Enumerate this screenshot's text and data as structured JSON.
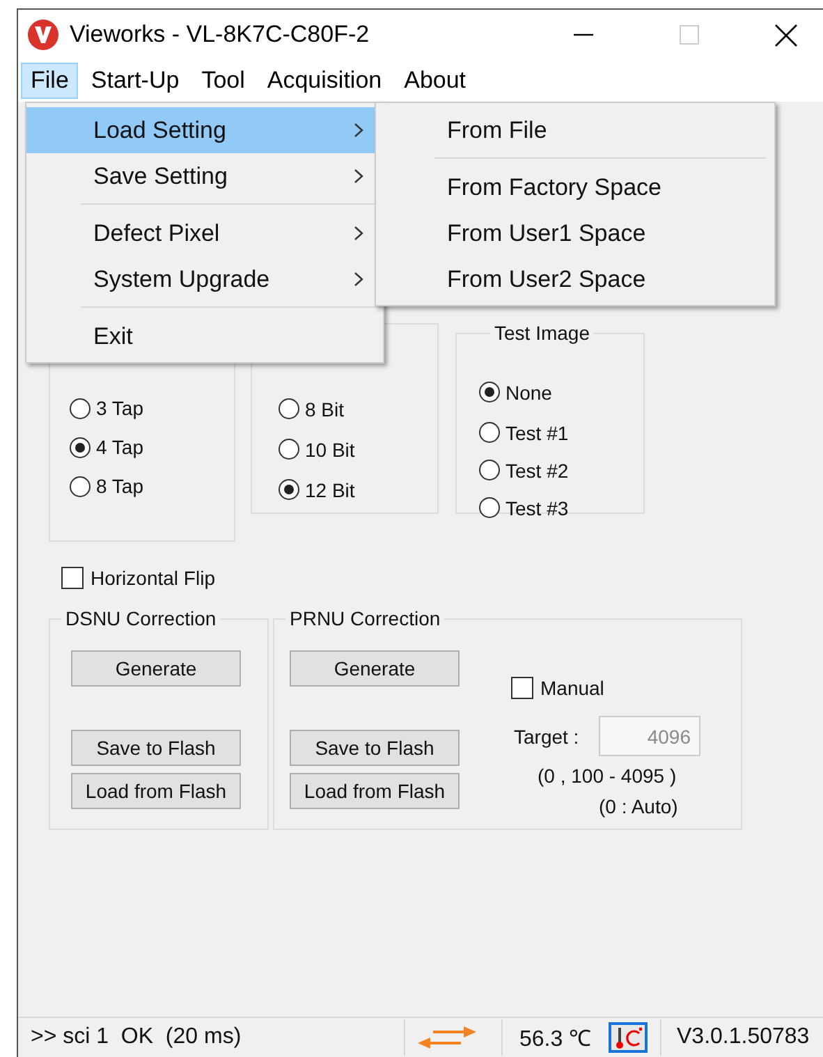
{
  "window": {
    "title": "Vieworks - VL-8K7C-C80F-2"
  },
  "menu_bar": [
    {
      "label": "File",
      "selected": true
    },
    {
      "label": "Start-Up",
      "selected": false
    },
    {
      "label": "Tool",
      "selected": false
    },
    {
      "label": "Acquisition",
      "selected": false
    },
    {
      "label": "About",
      "selected": false
    }
  ],
  "file_menu": {
    "items": [
      {
        "kind": "item",
        "label": "Load Setting",
        "submenu": true,
        "selected": true
      },
      {
        "kind": "item",
        "label": "Save Setting",
        "submenu": true,
        "selected": false
      },
      {
        "kind": "separator"
      },
      {
        "kind": "item",
        "label": "Defect Pixel",
        "submenu": true,
        "selected": false
      },
      {
        "kind": "item",
        "label": "System Upgrade",
        "submenu": true,
        "selected": false
      },
      {
        "kind": "separator"
      },
      {
        "kind": "item",
        "label": "Exit",
        "submenu": false,
        "selected": false
      }
    ]
  },
  "load_setting_submenu": {
    "items": [
      {
        "kind": "item",
        "label": "From File",
        "submenu": false,
        "selected": false
      },
      {
        "kind": "separator"
      },
      {
        "kind": "item",
        "label": "From Factory Space",
        "submenu": false,
        "selected": false
      },
      {
        "kind": "item",
        "label": "From User1 Space",
        "submenu": false,
        "selected": false
      },
      {
        "kind": "item",
        "label": "From User2 Space",
        "submenu": false,
        "selected": false
      }
    ]
  },
  "tap_group": {
    "options": [
      {
        "label": "3 Tap",
        "selected": false
      },
      {
        "label": "4 Tap",
        "selected": true
      },
      {
        "label": "8 Tap",
        "selected": false
      }
    ]
  },
  "bit_group": {
    "options": [
      {
        "label": "8 Bit",
        "selected": false
      },
      {
        "label": "10 Bit",
        "selected": false
      },
      {
        "label": "12 Bit",
        "selected": true
      }
    ]
  },
  "test_image": {
    "title": "Test Image",
    "options": [
      {
        "label": "None",
        "selected": true
      },
      {
        "label": "Test #1",
        "selected": false
      },
      {
        "label": "Test #2",
        "selected": false
      },
      {
        "label": "Test #3",
        "selected": false
      }
    ]
  },
  "horizontal_flip": {
    "label": "Horizontal Flip",
    "checked": false
  },
  "dsnu": {
    "title": "DSNU Correction",
    "buttons": [
      "Generate",
      "Save to Flash",
      "Load from Flash"
    ]
  },
  "prnu": {
    "title": "PRNU Correction",
    "buttons": [
      "Generate",
      "Save to Flash",
      "Load from Flash"
    ],
    "manual": {
      "label": "Manual",
      "checked": false
    },
    "target": {
      "label": "Target :",
      "value": "4096",
      "disabled": true
    },
    "range": "(0 , 100 - 4095 )",
    "auto_note": "(0 : Auto)"
  },
  "status_bar": {
    "message": ">> sci 1  OK  (20 ms)",
    "temperature": "56.3 ℃",
    "version": "V3.0.1.50783"
  }
}
